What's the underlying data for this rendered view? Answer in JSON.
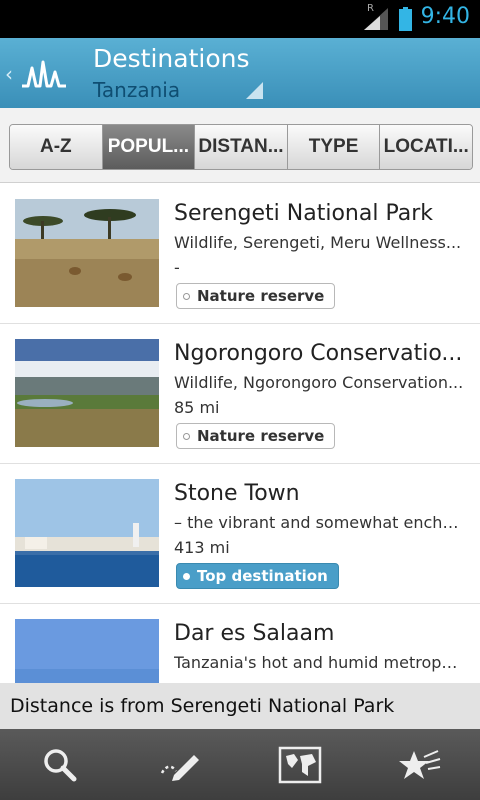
{
  "status": {
    "time": "9:40",
    "roaming_label": "R",
    "icons": [
      "signal-icon",
      "battery-icon"
    ]
  },
  "action_bar": {
    "title": "Destinations",
    "subtitle": "Tanzania",
    "accent": "#4fa3cc"
  },
  "tabs": [
    {
      "label": "A-Z",
      "active": false
    },
    {
      "label": "POPUL...",
      "active": true
    },
    {
      "label": "DISTAN...",
      "active": false
    },
    {
      "label": "TYPE",
      "active": false
    },
    {
      "label": "LOCATI...",
      "active": false
    }
  ],
  "destinations": [
    {
      "title": "Serengeti National Park",
      "desc": "Wildlife, Serengeti, Meru Wellness...",
      "distance": "-",
      "tag": "Nature reserve"
    },
    {
      "title": "Ngorongoro Conservatio...",
      "desc": "Wildlife, Ngorongoro Conservation...",
      "distance": "85 mi",
      "tag": "Nature reserve"
    },
    {
      "title": "Stone Town",
      "desc": "– the vibrant and somewhat encha...",
      "distance": "413 mi",
      "tag": "Top destination"
    },
    {
      "title": "Dar es Salaam",
      "desc": "Tanzania's hot and humid metropo...",
      "distance": "",
      "tag": ""
    }
  ],
  "footer_note": "Distance is from Serengeti National Park",
  "bottom_nav": [
    "search-icon",
    "edit-icon",
    "map-icon",
    "favorites-icon"
  ]
}
